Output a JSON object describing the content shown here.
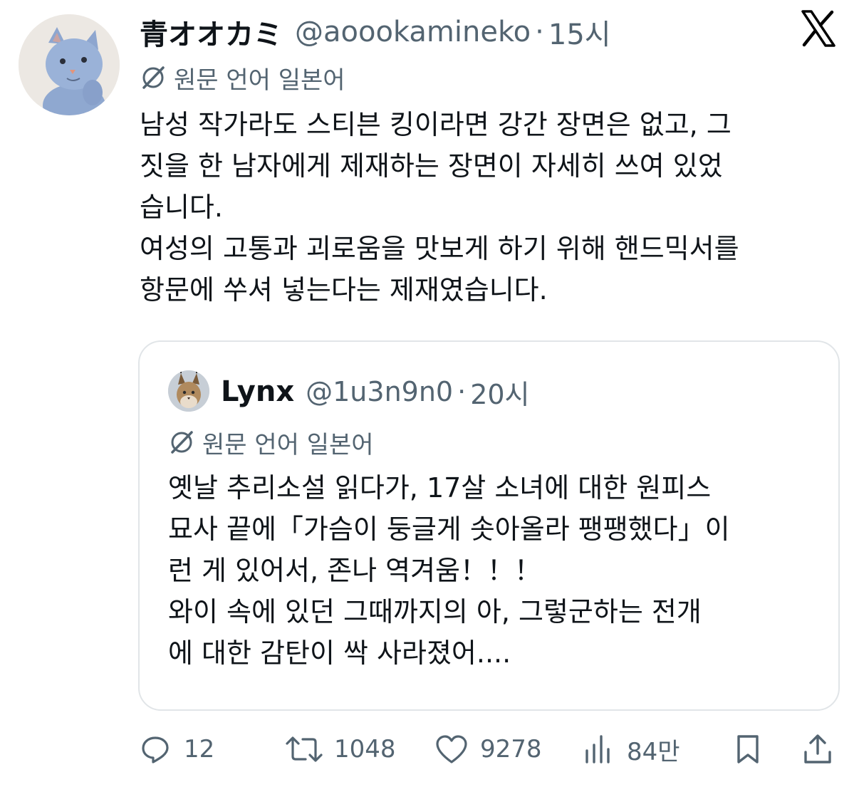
{
  "author": {
    "display_name": "青オオカミ",
    "handle": "@aoookamineko",
    "separator": "·",
    "time": "15시"
  },
  "translation_label": "원문 언어 일본어",
  "tweet_lines": [
    "남성 작가라도 스티븐 킹이라면 강간 장면은 없고, 그",
    "짓을 한 남자에게 제재하는 장면이 자세히 쓰여 있었",
    "습니다.",
    "여성의 고통과 괴로움을 맛보게 하기 위해 핸드믹서를",
    "항문에 쑤셔 넣는다는 제재였습니다."
  ],
  "quoted": {
    "display_name": "Lynx",
    "handle": "@1u3n9n0",
    "separator": "·",
    "time": "20시",
    "translation_label": "원문 언어 일본어",
    "lines": [
      "옛날 추리소설 읽다가, 17살 소녀에 대한 원피스",
      "묘사 끝에「가슴이 둥글게 솟아올라 팽팽했다」이",
      "런 게 있어서, 존나 역겨움！！！",
      "와이 속에 있던 그때까지의 아, 그렇군하는 전개",
      "에 대한 감탄이 싹 사라졌어...."
    ]
  },
  "actions": {
    "replies": "12",
    "reposts": "1048",
    "likes": "9278",
    "views": "84만"
  },
  "icons": {
    "brand": "x-logo-icon",
    "translate": "globe-slash-icon",
    "reply": "reply-icon",
    "repost": "repost-icon",
    "like": "heart-icon",
    "views": "views-icon",
    "bookmark": "bookmark-icon",
    "share": "share-icon"
  },
  "colors": {
    "text": "#0f1419",
    "muted": "#536471",
    "border": "#e1e5e8"
  }
}
